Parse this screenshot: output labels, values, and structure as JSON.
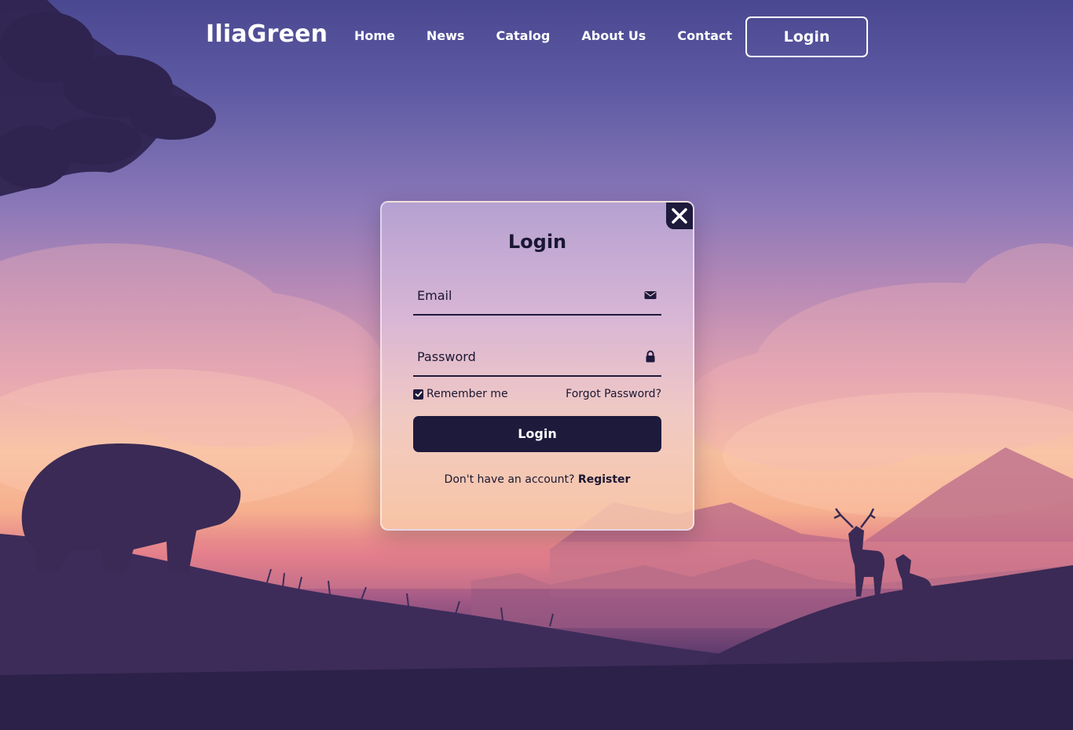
{
  "header": {
    "logo": "IliaGreen",
    "nav": [
      "Home",
      "News",
      "Catalog",
      "About Us",
      "Contact"
    ],
    "login_button": "Login"
  },
  "modal": {
    "title": "Login",
    "email_placeholder": "Email",
    "password_placeholder": "Password",
    "remember_label": "Remember me",
    "remember_checked": true,
    "forgot_label": "Forgot Password?",
    "submit_label": "Login",
    "register_prompt": "Don't have an account?",
    "register_link": "Register"
  },
  "icons": {
    "email": "envelope-icon",
    "password": "lock-icon",
    "close": "close-icon",
    "checkbox": "check-icon"
  },
  "colors": {
    "dark": "#1e1a3c",
    "text_light": "#ffffff"
  }
}
